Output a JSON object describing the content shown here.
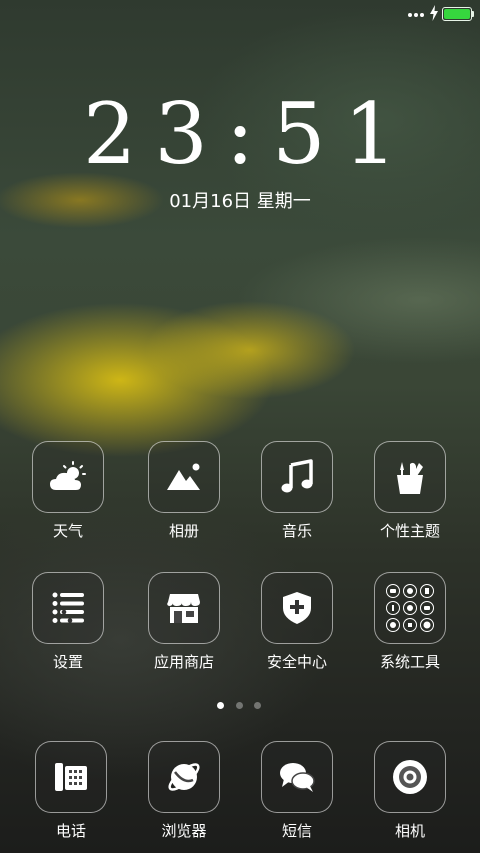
{
  "status_bar": {
    "signal_icon": "more-dots-icon",
    "charging_icon": "charging-bolt-icon",
    "battery_icon": "battery-icon",
    "battery_level": 1.0,
    "battery_color": "#36d63e"
  },
  "lockscreen": {
    "time": "23:51",
    "date": "01月16日 星期一"
  },
  "apps": {
    "weather": {
      "label": "天气",
      "icon": "weather-icon"
    },
    "gallery": {
      "label": "相册",
      "icon": "gallery-icon"
    },
    "music": {
      "label": "音乐",
      "icon": "music-note-icon"
    },
    "themes": {
      "label": "个性主题",
      "icon": "themes-icon"
    },
    "settings": {
      "label": "设置",
      "icon": "settings-list-icon"
    },
    "app_store": {
      "label": "应用商店",
      "icon": "store-icon"
    },
    "security": {
      "label": "安全中心",
      "icon": "shield-icon"
    },
    "tools": {
      "label": "系统工具",
      "icon": "tools-folder-icon"
    }
  },
  "pager": {
    "pages": 3,
    "current": 1
  },
  "dock": {
    "phone": {
      "label": "电话",
      "icon": "phone-icon"
    },
    "browser": {
      "label": "浏览器",
      "icon": "browser-icon"
    },
    "sms": {
      "label": "短信",
      "icon": "sms-icon"
    },
    "camera": {
      "label": "相机",
      "icon": "camera-icon"
    }
  }
}
